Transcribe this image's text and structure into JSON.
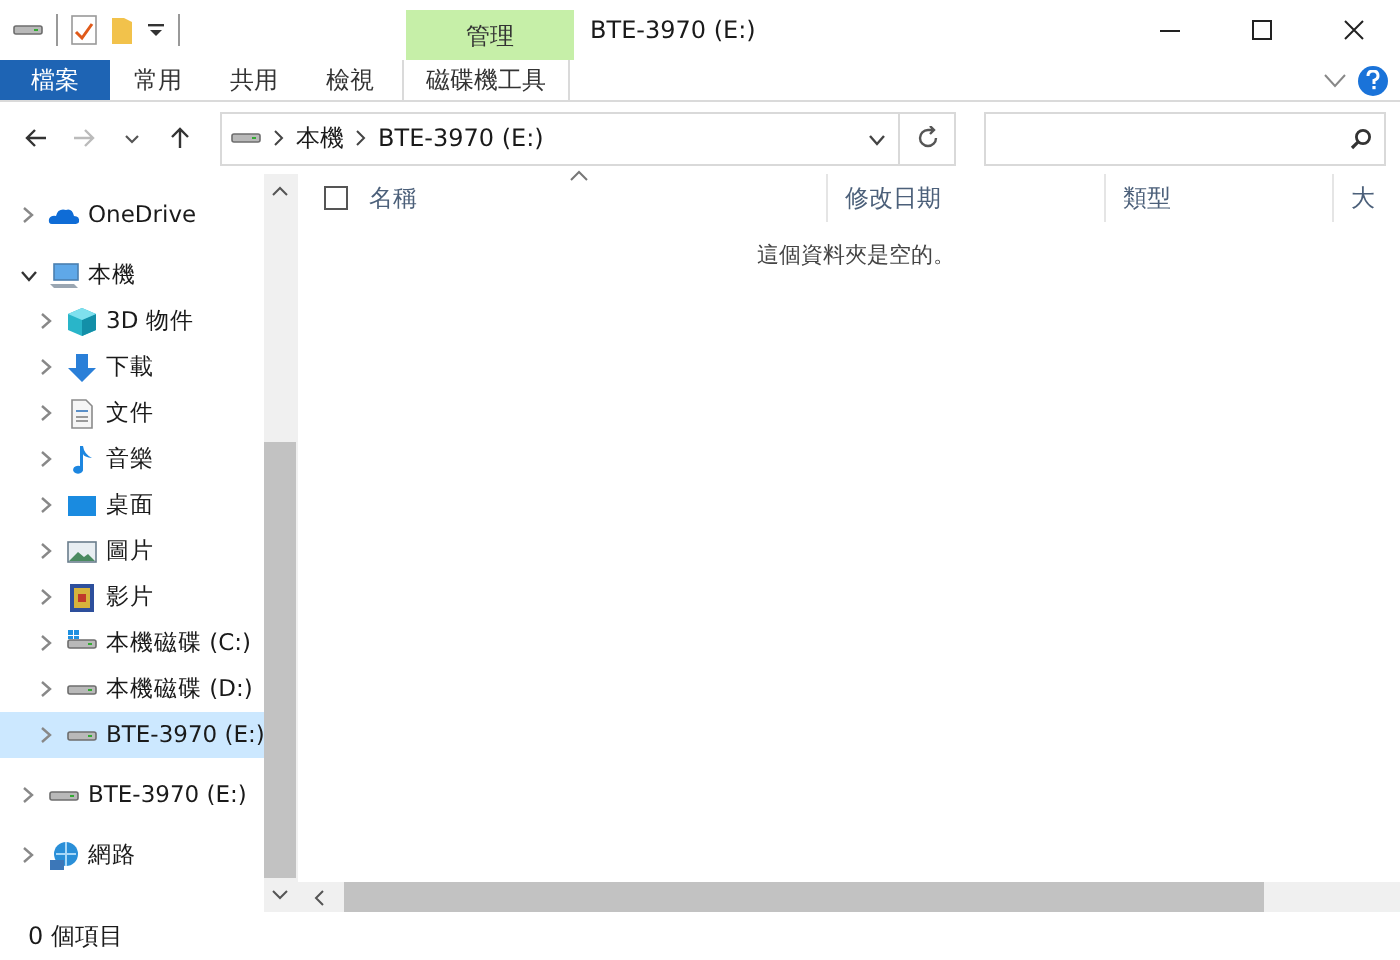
{
  "window": {
    "title": "BTE-3970 (E:)",
    "context_label": "管理"
  },
  "quick_access": [
    {
      "kind": "drive"
    },
    {
      "kind": "properties"
    },
    {
      "kind": "folder"
    },
    {
      "kind": "caret"
    }
  ],
  "ribbon_tabs": [
    {
      "label": "檔案",
      "kind": "file"
    },
    {
      "label": "常用",
      "kind": "normal"
    },
    {
      "label": "共用",
      "kind": "normal"
    },
    {
      "label": "檢視",
      "kind": "normal"
    },
    {
      "label": "磁碟機工具",
      "kind": "context"
    }
  ],
  "navigation": {
    "back_disabled": false,
    "forward_disabled": true
  },
  "address": {
    "crumbs": [
      "本機",
      "BTE-3970 (E:)"
    ]
  },
  "tree": [
    {
      "label": "OneDrive",
      "kind": "onedrive",
      "expanded": false,
      "selected": false
    },
    {
      "label": "本機",
      "kind": "pc",
      "expanded": true,
      "selected": false,
      "children": [
        {
          "label": "3D 物件",
          "kind": "cube",
          "expanded": false,
          "selected": false
        },
        {
          "label": "下載",
          "kind": "download",
          "expanded": false,
          "selected": false
        },
        {
          "label": "文件",
          "kind": "document",
          "expanded": false,
          "selected": false
        },
        {
          "label": "音樂",
          "kind": "music",
          "expanded": false,
          "selected": false
        },
        {
          "label": "桌面",
          "kind": "desktop",
          "expanded": false,
          "selected": false
        },
        {
          "label": "圖片",
          "kind": "pictures",
          "expanded": false,
          "selected": false
        },
        {
          "label": "影片",
          "kind": "videos",
          "expanded": false,
          "selected": false
        },
        {
          "label": "本機磁碟 (C:)",
          "kind": "system-drive",
          "expanded": false,
          "selected": false
        },
        {
          "label": "本機磁碟 (D:)",
          "kind": "drive",
          "expanded": false,
          "selected": false
        },
        {
          "label": "BTE-3970 (E:)",
          "kind": "drive",
          "expanded": false,
          "selected": true
        }
      ]
    },
    {
      "label": "BTE-3970 (E:)",
      "kind": "drive",
      "expanded": false,
      "selected": false
    },
    {
      "label": "網路",
      "kind": "network",
      "expanded": false,
      "selected": false
    }
  ],
  "table": {
    "select_all": {
      "checked": false
    },
    "columns": [
      {
        "label": "名稱",
        "sorted": true
      },
      {
        "label": "修改日期",
        "sorted": false
      },
      {
        "label": "類型",
        "sorted": false
      },
      {
        "label": "大",
        "sorted": false
      }
    ],
    "empty_message": "這個資料夾是空的。"
  },
  "status_bar": {
    "text": "0 個項目"
  }
}
